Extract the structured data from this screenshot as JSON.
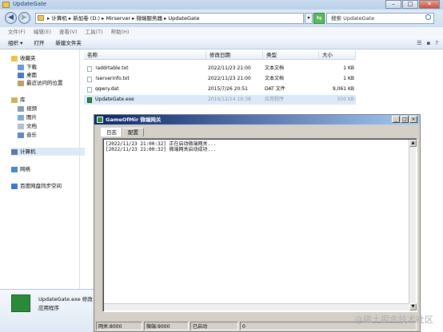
{
  "explorer": {
    "title": "UpdateGate",
    "breadcrumb": "▸ 计算机 ▸ 新加卷 (D:) ▸ Mirserver ▸ 微端服务器 ▸ UpdateGate",
    "search_placeholder": "搜索 UpdateGate",
    "menu": [
      "文件(F)",
      "编辑(E)",
      "查看(V)",
      "工具(T)",
      "帮助(H)"
    ],
    "toolbar": [
      "组织 ▾",
      "打开",
      "新建文件夹"
    ],
    "sidebar": {
      "favorites": "收藏夹",
      "downloads": "下载",
      "desktop": "桌面",
      "recent": "最近访问的位置",
      "libraries": "库",
      "videos": "视频",
      "pictures": "图片",
      "documents": "文档",
      "music": "音乐",
      "computer": "计算机",
      "network": "网络",
      "baidu": "百度网盘同步空间"
    },
    "columns": [
      "名称",
      "修改日期",
      "类型",
      "大小"
    ],
    "files": [
      {
        "name": "!addrtable.txt",
        "date": "2022/11/23 21:00",
        "type": "文本文档",
        "size": "1 KB"
      },
      {
        "name": "!serverinfo.txt",
        "date": "2022/11/23 21:00",
        "type": "文本文档",
        "size": "1 KB"
      },
      {
        "name": "qqwry.dat",
        "date": "2015/7/26 20:51",
        "type": "DAT 文件",
        "size": "9,061 KB"
      },
      {
        "name": "UpdateGate.exe",
        "date": "2016/12/14 19:38",
        "type": "应用程序",
        "size": "500 KB"
      }
    ],
    "details": {
      "name": "UpdateGate.exe 修改",
      "type": "应用程序"
    }
  },
  "game_window": {
    "title": "GameOfMir 微端网关",
    "tabs": [
      "日志",
      "配置"
    ],
    "log": [
      "[2022/11/23 21:00:32] 正在启动微端网关...",
      "[2022/11/23 21:00:32] 微端网关启动成功..."
    ],
    "status": [
      "网关:8000",
      "微端:9000",
      "已启动",
      "0"
    ]
  },
  "watermark": "@稀土掘金技术社区"
}
